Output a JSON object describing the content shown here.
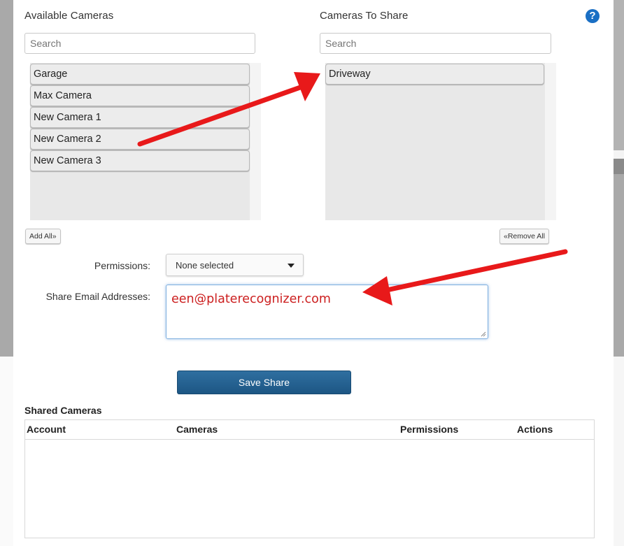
{
  "available": {
    "title": "Available Cameras",
    "search_placeholder": "Search",
    "items": [
      "Garage",
      "Max Camera",
      "New Camera 1",
      "New Camera 2",
      "New Camera 3"
    ],
    "add_all_label": "Add All»"
  },
  "to_share": {
    "title": "Cameras To Share",
    "search_placeholder": "Search",
    "items": [
      "Driveway"
    ],
    "remove_all_label": "«Remove All"
  },
  "help_icon": "question-circle-icon",
  "form": {
    "permissions_label": "Permissions:",
    "permissions_value": "None selected",
    "emails_label": "Share Email Addresses:",
    "emails_value": "een@platerecognizer.com",
    "save_label": "Save Share"
  },
  "shared": {
    "title": "Shared Cameras",
    "columns": [
      "Account",
      "Cameras",
      "Permissions",
      "Actions"
    ]
  },
  "colors": {
    "primary_button": "#1d5684",
    "help_icon": "#1a6fc4",
    "annotation_arrow": "#e8191a",
    "email_text": "#cc1f1f"
  }
}
